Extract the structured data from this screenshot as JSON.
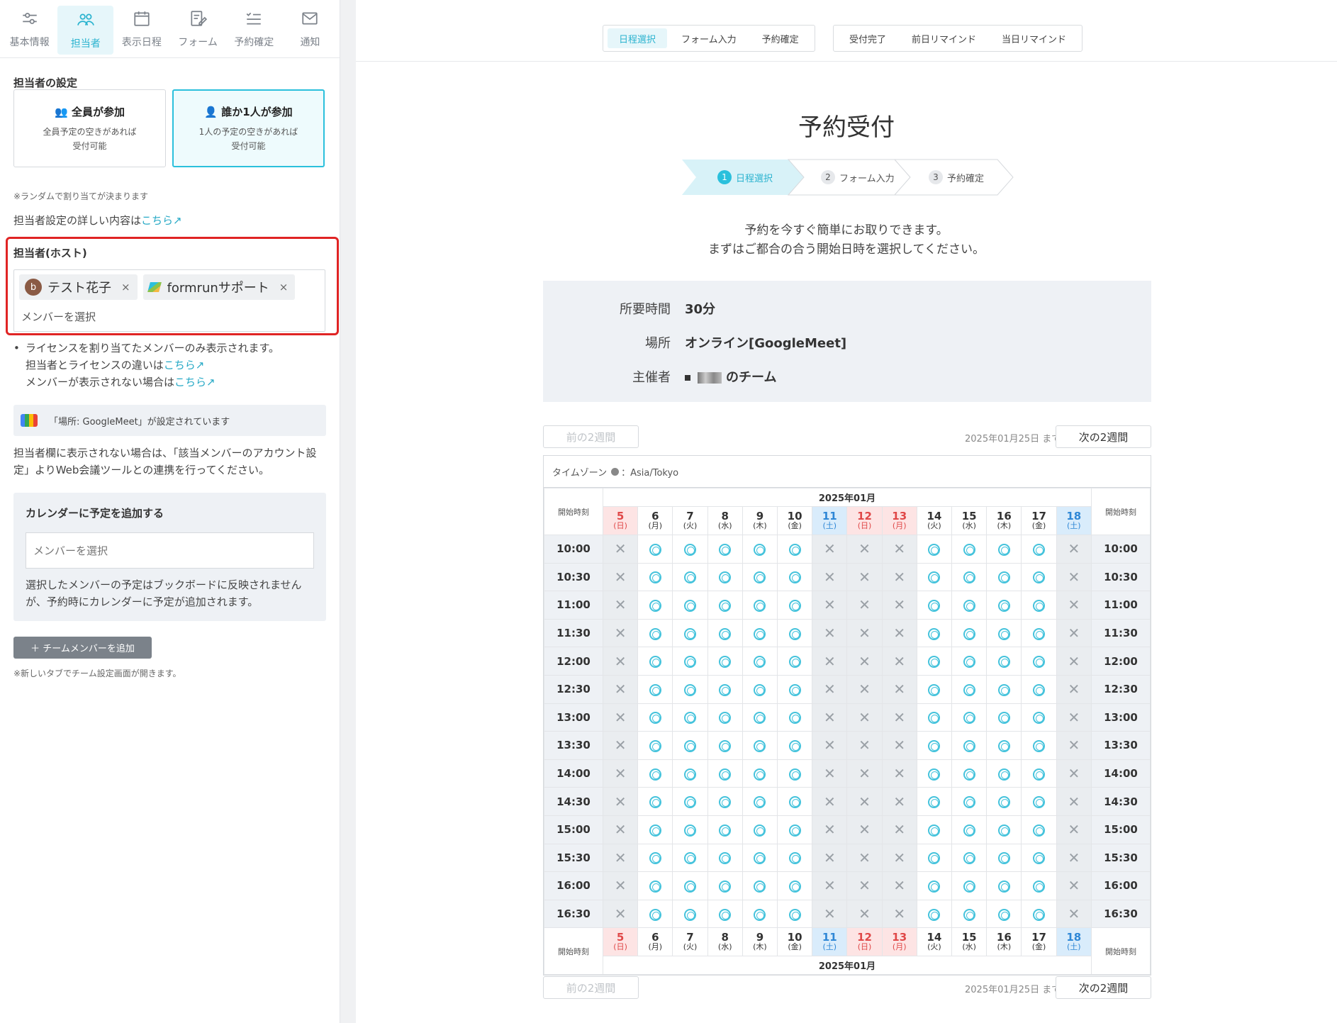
{
  "nav": {
    "tabs": [
      {
        "label": "基本情報",
        "icon": "sliders-icon"
      },
      {
        "label": "担当者",
        "icon": "users-icon"
      },
      {
        "label": "表示日程",
        "icon": "calendar-icon"
      },
      {
        "label": "フォーム",
        "icon": "form-edit-icon"
      },
      {
        "label": "予約確定",
        "icon": "checklist-icon"
      },
      {
        "label": "通知",
        "icon": "mail-icon"
      }
    ],
    "active": "担当者"
  },
  "assignee": {
    "title": "担当者の設定",
    "option_all": {
      "title": "全員が参加",
      "desc1": "全員予定の空きがあれば",
      "desc2": "受付可能"
    },
    "option_one": {
      "title": "誰か1人が参加",
      "desc1": "1人の予定の空きがあれば",
      "desc2": "受付可能"
    },
    "random_note": "※ランダムで割り当てが決まります",
    "detail_text": "担当者設定の詳しい内容は",
    "detail_link": "こちら"
  },
  "host": {
    "title": "担当者(ホスト)",
    "chips": [
      {
        "avatar": "b",
        "name": "テスト花子"
      },
      {
        "name": "formrunサポート"
      }
    ],
    "remove": "×",
    "placeholder": "メンバーを選択"
  },
  "license_notes": {
    "line1": "ライセンスを割り当てたメンバーのみ表示されます。",
    "line2": "担当者とライセンスの違いは",
    "line3": "メンバーが表示されない場合は",
    "link": "こちら"
  },
  "googlemeet_notice": "「場所: GoogleMeet」が設定されています",
  "meet_help": {
    "line1": "担当者欄に表示されない場合は、「該当メンバーのアカウント設",
    "line2": "定」よりWeb会議ツールとの連携を行ってください。"
  },
  "calendar_add": {
    "title": "カレンダーに予定を追加する",
    "placeholder": "メンバーを選択",
    "desc1": "選択したメンバーの予定はブックボードに反映されません",
    "desc2": "が、予約時にカレンダーに予定が追加されます。"
  },
  "add_member": {
    "label": "＋  チームメンバーを追加",
    "note": "※新しいタブでチーム設定画面が開きます。"
  },
  "preview": {
    "tab_group1": [
      "日程選択",
      "フォーム入力",
      "予約確定"
    ],
    "tab_group2": [
      "受付完了",
      "前日リマインド",
      "当日リマインド"
    ],
    "active_tab": "日程選択",
    "title": "予約受付",
    "steps": [
      {
        "num": "1",
        "label": "日程選択"
      },
      {
        "num": "2",
        "label": "フォーム入力"
      },
      {
        "num": "3",
        "label": "予約確定"
      }
    ],
    "intro1": "予約を今すぐ簡単にお取りできます。",
    "intro2": "まずはご都合の合う開始日時を選択してください。",
    "info": {
      "duration_label": "所要時間",
      "duration_value": "30分",
      "place_label": "場所",
      "place_value": "オンライン[GoogleMeet]",
      "host_label": "主催者",
      "host_value": "のチーム"
    },
    "prev_label": "前の2週間",
    "next_label": "次の2週間",
    "until_label": "2025年01月25日 まで",
    "timezone_label": "タイムゾーン",
    "timezone_value": "：Asia/Tokyo",
    "month": "2025年01月",
    "start_time_label": "開始時刻",
    "days": [
      {
        "d": "5",
        "w": "(日)",
        "type": "sun"
      },
      {
        "d": "6",
        "w": "(月)",
        "type": "wk"
      },
      {
        "d": "7",
        "w": "(火)",
        "type": "wk"
      },
      {
        "d": "8",
        "w": "(水)",
        "type": "wk"
      },
      {
        "d": "9",
        "w": "(木)",
        "type": "wk"
      },
      {
        "d": "10",
        "w": "(金)",
        "type": "wk"
      },
      {
        "d": "11",
        "w": "(土)",
        "type": "sat"
      },
      {
        "d": "12",
        "w": "(日)",
        "type": "sun"
      },
      {
        "d": "13",
        "w": "(月)",
        "type": "hol"
      },
      {
        "d": "14",
        "w": "(火)",
        "type": "wk"
      },
      {
        "d": "15",
        "w": "(水)",
        "type": "wk"
      },
      {
        "d": "16",
        "w": "(木)",
        "type": "wk"
      },
      {
        "d": "17",
        "w": "(金)",
        "type": "wk"
      },
      {
        "d": "18",
        "w": "(土)",
        "type": "sat"
      }
    ],
    "times": [
      "10:00",
      "10:30",
      "11:00",
      "11:30",
      "12:00",
      "12:30",
      "13:00",
      "13:30",
      "14:00",
      "14:30",
      "15:00",
      "15:30",
      "16:00",
      "16:30"
    ],
    "availability": [
      false,
      true,
      true,
      true,
      true,
      true,
      false,
      false,
      false,
      true,
      true,
      true,
      true,
      false
    ]
  }
}
